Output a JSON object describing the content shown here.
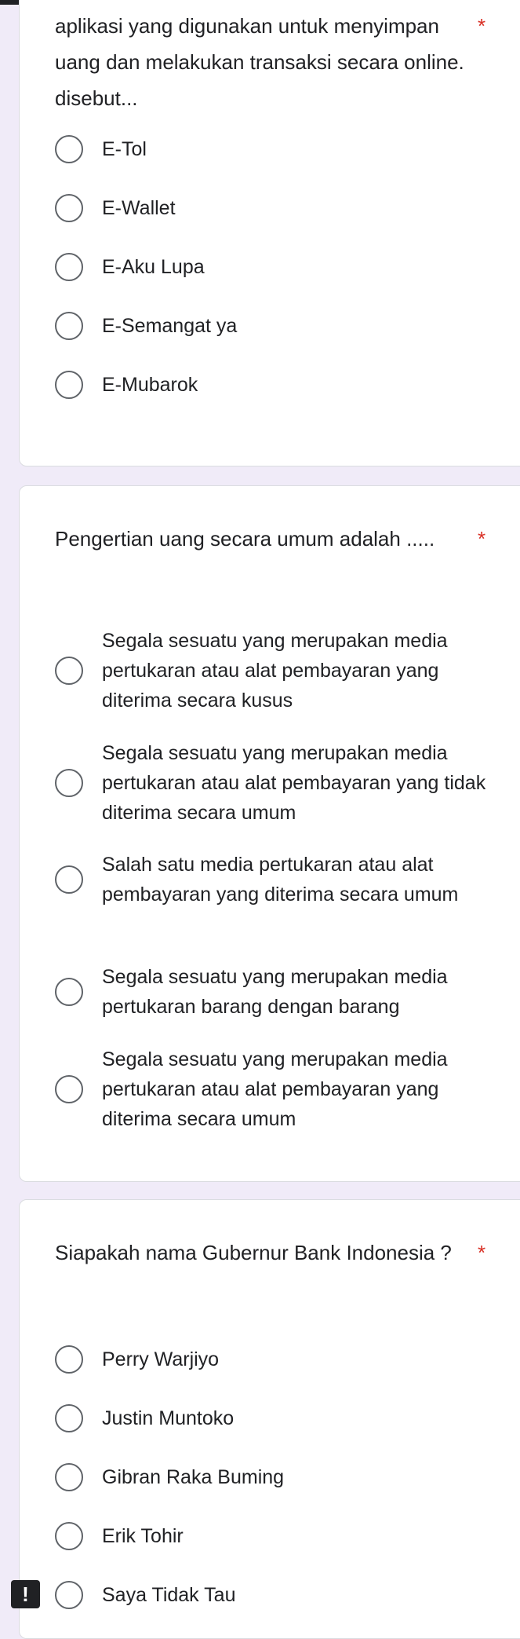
{
  "q1": {
    "title": "aplikasi yang digunakan untuk menyimpan uang dan melakukan transaksi secara online. disebut...",
    "required": "*",
    "options": [
      "E-Tol",
      "E-Wallet",
      "E-Aku Lupa",
      "E-Semangat ya",
      "E-Mubarok"
    ]
  },
  "q2": {
    "title": "Pengertian uang secara umum adalah .....",
    "required": "*",
    "options": [
      "Segala sesuatu yang merupakan media pertukaran atau alat pembayaran yang diterima secara kusus",
      "Segala sesuatu yang merupakan media pertukaran atau alat pembayaran yang tidak diterima secara umum",
      "Salah satu media pertukaran atau alat pembayaran yang diterima secara umum",
      "Segala sesuatu yang merupakan media pertukaran barang dengan barang",
      "Segala sesuatu yang merupakan media pertukaran atau alat pembayaran yang diterima secara umum"
    ]
  },
  "q3": {
    "title": "Siapakah nama Gubernur Bank Indonesia ?",
    "required": "*",
    "options": [
      "Perry Warjiyo",
      "Justin Muntoko",
      "Gibran Raka Buming",
      "Erik Tohir",
      "Saya Tidak Tau"
    ]
  },
  "alert_icon": {
    "symbol": "!",
    "icon": "exclamation-icon"
  }
}
